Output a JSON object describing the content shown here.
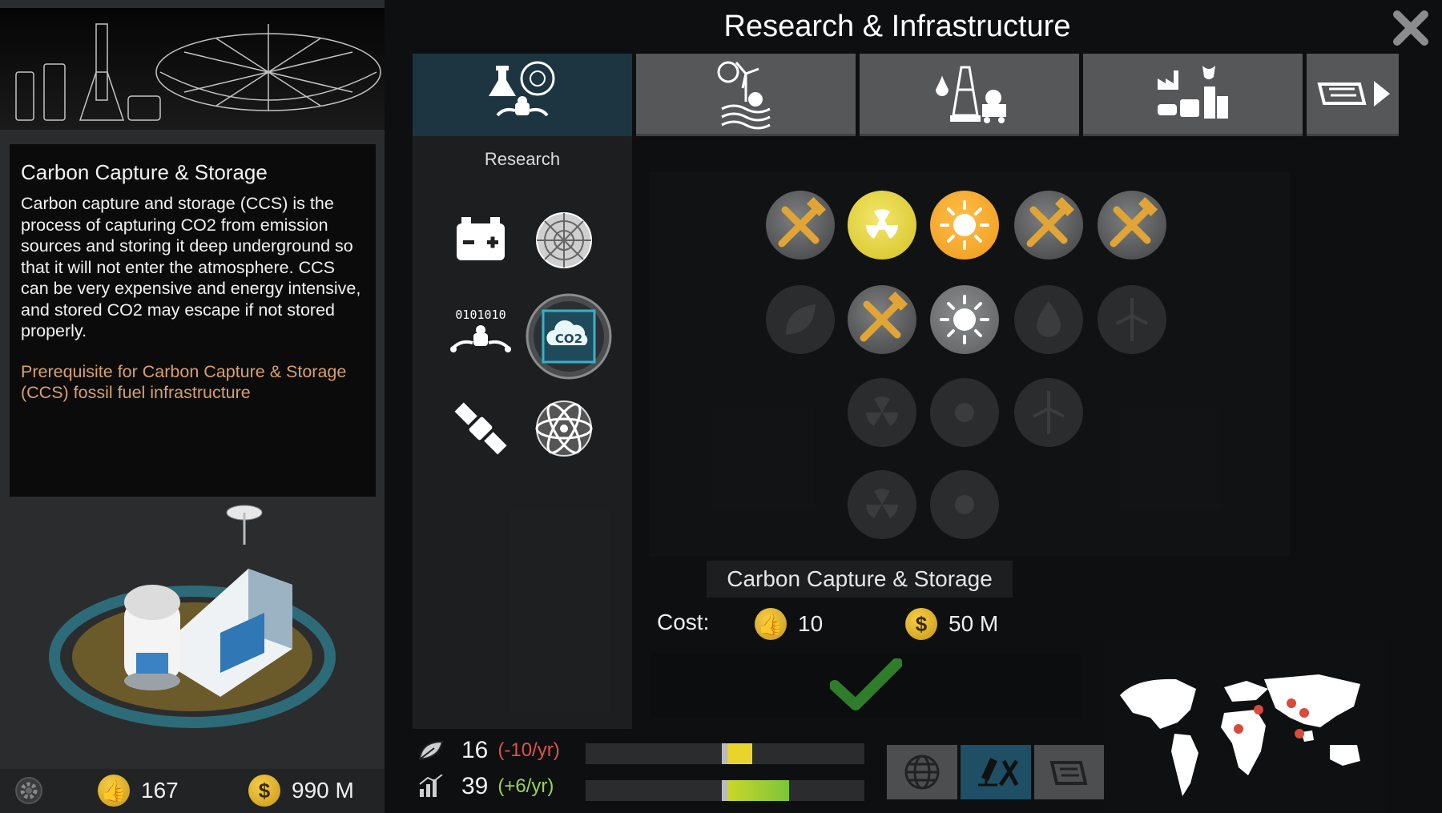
{
  "header": {
    "title": "Research & Infrastructure"
  },
  "info_panel": {
    "title": "Carbon Capture & Storage",
    "body": "Carbon capture and storage (CCS) is the process of capturing CO2 from emission sources and storing it deep underground so that it will not enter the atmosphere. CCS can be very expensive and energy intensive, and stored CO2 may escape if not stored properly.",
    "prerequisite": "Prerequisite for Carbon Capture & Storage (CCS) fossil fuel infrastructure"
  },
  "tabs": [
    {
      "icon": "research-tab-icon",
      "active": true
    },
    {
      "icon": "renewable-energy-tab-icon",
      "active": false
    },
    {
      "icon": "fossil-fuel-tab-icon",
      "active": false
    },
    {
      "icon": "industry-tab-icon",
      "active": false
    },
    {
      "icon": "policy-next-tab-icon",
      "active": false
    }
  ],
  "research": {
    "label": "Research",
    "items": [
      "battery-icon",
      "nanomaterial-icon",
      "robotics-ai-icon",
      "co2-capture-icon",
      "satellite-icon",
      "atom-icon"
    ],
    "selected": "co2-capture-icon",
    "co2_label": "CO2"
  },
  "selected_item": {
    "name": "Carbon Capture & Storage",
    "cost_label": "Cost:",
    "cost_approval": "10",
    "cost_money": "50 M"
  },
  "player": {
    "approval": "167",
    "money": "990 M"
  },
  "metrics": {
    "emissions": {
      "value": "16",
      "delta": "(-10/yr)",
      "delta_color": "#e0524a",
      "level": 0.09
    },
    "development": {
      "value": "39",
      "delta": "(+6/yr)",
      "delta_color": "#9ad64a",
      "level": 0.22
    }
  },
  "colors": {
    "accent": "#1d3540",
    "gold": "#f0c23a",
    "prereq": "#d9a06a",
    "check": "#2f7d2a"
  }
}
